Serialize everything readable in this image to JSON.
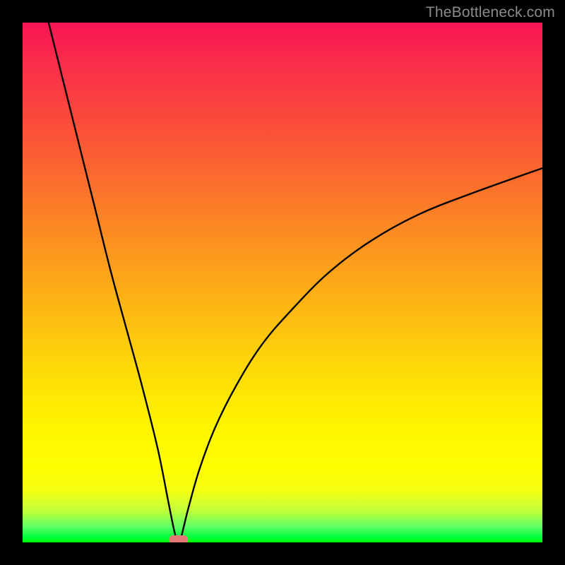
{
  "attribution": "TheBottleneck.com",
  "chart_data": {
    "type": "line",
    "title": "",
    "xlabel": "",
    "ylabel": "",
    "xlim": [
      0,
      100
    ],
    "ylim": [
      0,
      100
    ],
    "context": "Bottleneck percentage vs. component index. V-shaped curve: minimum (≈0%) near x≈30; left branch rises steeply to ~100% at x≈5; right branch rises with diminishing slope toward ~72% at x=100.",
    "series": [
      {
        "name": "bottleneck-curve",
        "x": [
          5,
          8,
          11,
          14,
          17,
          20,
          23,
          26,
          28,
          29,
          29.5,
          30,
          30.5,
          31,
          32,
          34,
          37,
          41,
          46,
          52,
          59,
          67,
          76,
          86,
          100
        ],
        "values": [
          100,
          88,
          76,
          64,
          52,
          41,
          30,
          18,
          8,
          3,
          1,
          0,
          1,
          3,
          7,
          14,
          22,
          30,
          38,
          45,
          52,
          58,
          63,
          67,
          72
        ]
      }
    ],
    "minimum_marker": {
      "x": 30,
      "y": 0,
      "shape": "rounded-capsule",
      "color": "#e37773"
    },
    "background_gradient": {
      "orientation": "vertical",
      "stops": [
        {
          "pos": 0.0,
          "color": "#f71552"
        },
        {
          "pos": 0.24,
          "color": "#fb5934"
        },
        {
          "pos": 0.48,
          "color": "#fca31a"
        },
        {
          "pos": 0.78,
          "color": "#fef500"
        },
        {
          "pos": 0.97,
          "color": "#5dff65"
        },
        {
          "pos": 1.0,
          "color": "#00ff00"
        }
      ]
    }
  }
}
